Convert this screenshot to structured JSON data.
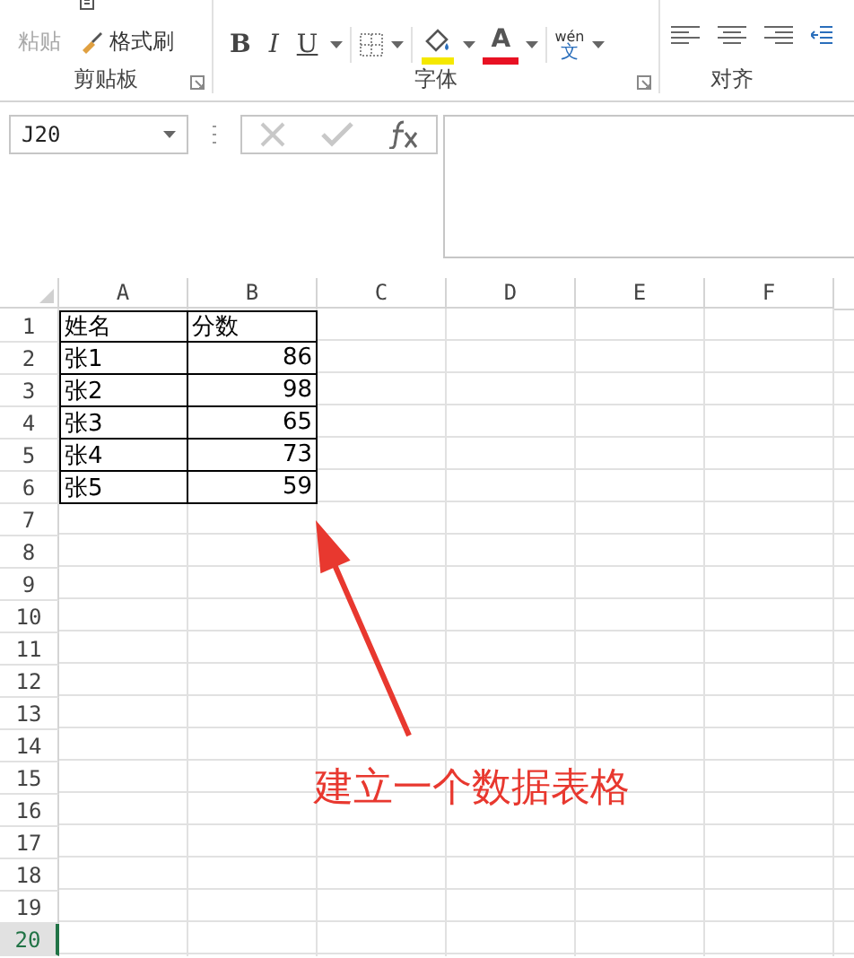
{
  "ribbon": {
    "groups": [
      {
        "kind": "clipboard",
        "label": "剪贴板",
        "paste": {
          "label": "粘贴",
          "disabled": true
        },
        "format_painter": {
          "label": "格式刷"
        }
      },
      {
        "kind": "font",
        "label": "字体",
        "bold": "B",
        "italic": "I",
        "underline": "U",
        "font_color": "A",
        "phonetic_top": "wén",
        "phonetic_bottom": "文"
      },
      {
        "kind": "align",
        "label": "对齐"
      }
    ]
  },
  "formula_bar": {
    "name_box": "J20"
  },
  "sheet": {
    "columns": [
      "A",
      "B",
      "C",
      "D",
      "E",
      "F"
    ],
    "rows": [
      {
        "header": "1",
        "selected": false,
        "cells": [
          "姓名",
          "分数"
        ]
      },
      {
        "header": "2",
        "selected": false,
        "cells": [
          "张1",
          "86"
        ]
      },
      {
        "header": "3",
        "selected": false,
        "cells": [
          "张2",
          "98"
        ]
      },
      {
        "header": "4",
        "selected": false,
        "cells": [
          "张3",
          "65"
        ]
      },
      {
        "header": "5",
        "selected": false,
        "cells": [
          "张4",
          "73"
        ]
      },
      {
        "header": "6",
        "selected": false,
        "cells": [
          "张5",
          "59"
        ]
      },
      {
        "header": "7",
        "selected": false,
        "cells": []
      },
      {
        "header": "8",
        "selected": false,
        "cells": []
      },
      {
        "header": "9",
        "selected": false,
        "cells": []
      },
      {
        "header": "10",
        "selected": false,
        "cells": []
      },
      {
        "header": "11",
        "selected": false,
        "cells": []
      },
      {
        "header": "12",
        "selected": false,
        "cells": []
      },
      {
        "header": "13",
        "selected": false,
        "cells": []
      },
      {
        "header": "14",
        "selected": false,
        "cells": []
      },
      {
        "header": "15",
        "selected": false,
        "cells": []
      },
      {
        "header": "16",
        "selected": false,
        "cells": []
      },
      {
        "header": "17",
        "selected": false,
        "cells": []
      },
      {
        "header": "18",
        "selected": false,
        "cells": []
      },
      {
        "header": "19",
        "selected": false,
        "cells": []
      },
      {
        "header": "20",
        "selected": true,
        "cells": []
      }
    ]
  },
  "annotation": {
    "text": "建立一个数据表格"
  }
}
